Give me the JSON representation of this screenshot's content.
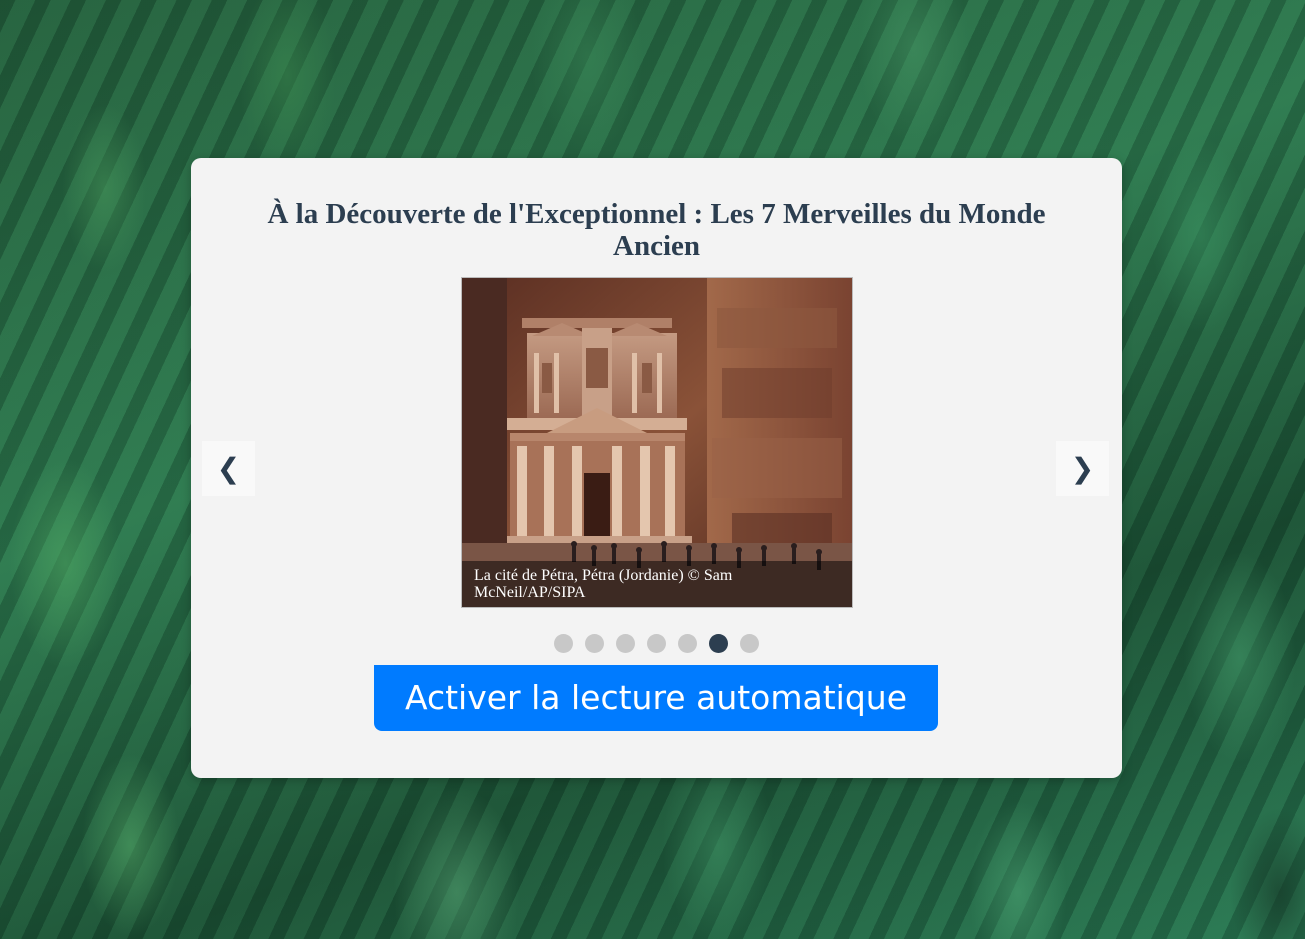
{
  "background": {
    "description_icon": "forest-background"
  },
  "carousel": {
    "title": "À la Découverte de l'Exceptionnel : Les 7 Merveilles du Monde Ancien",
    "slide": {
      "image_icon": "petra-treasury-photo",
      "caption": "La cité de Pétra, Pétra (Jordanie) © Sam McNeil/AP/SIPA"
    },
    "prev_label": "❮",
    "next_label": "❯",
    "dots": [
      {
        "active": false
      },
      {
        "active": false
      },
      {
        "active": false
      },
      {
        "active": false
      },
      {
        "active": false
      },
      {
        "active": true
      },
      {
        "active": false
      }
    ],
    "current_index": 6,
    "total_slides": 7,
    "autoplay_label": "Activer la lecture automatique"
  },
  "colors": {
    "card_bg": "#f3f3f3",
    "title": "#2c3e50",
    "dot_active": "#2c3e50",
    "dot_inactive": "#c8c8c8",
    "button_bg": "#007bff",
    "button_text": "#ffffff"
  }
}
